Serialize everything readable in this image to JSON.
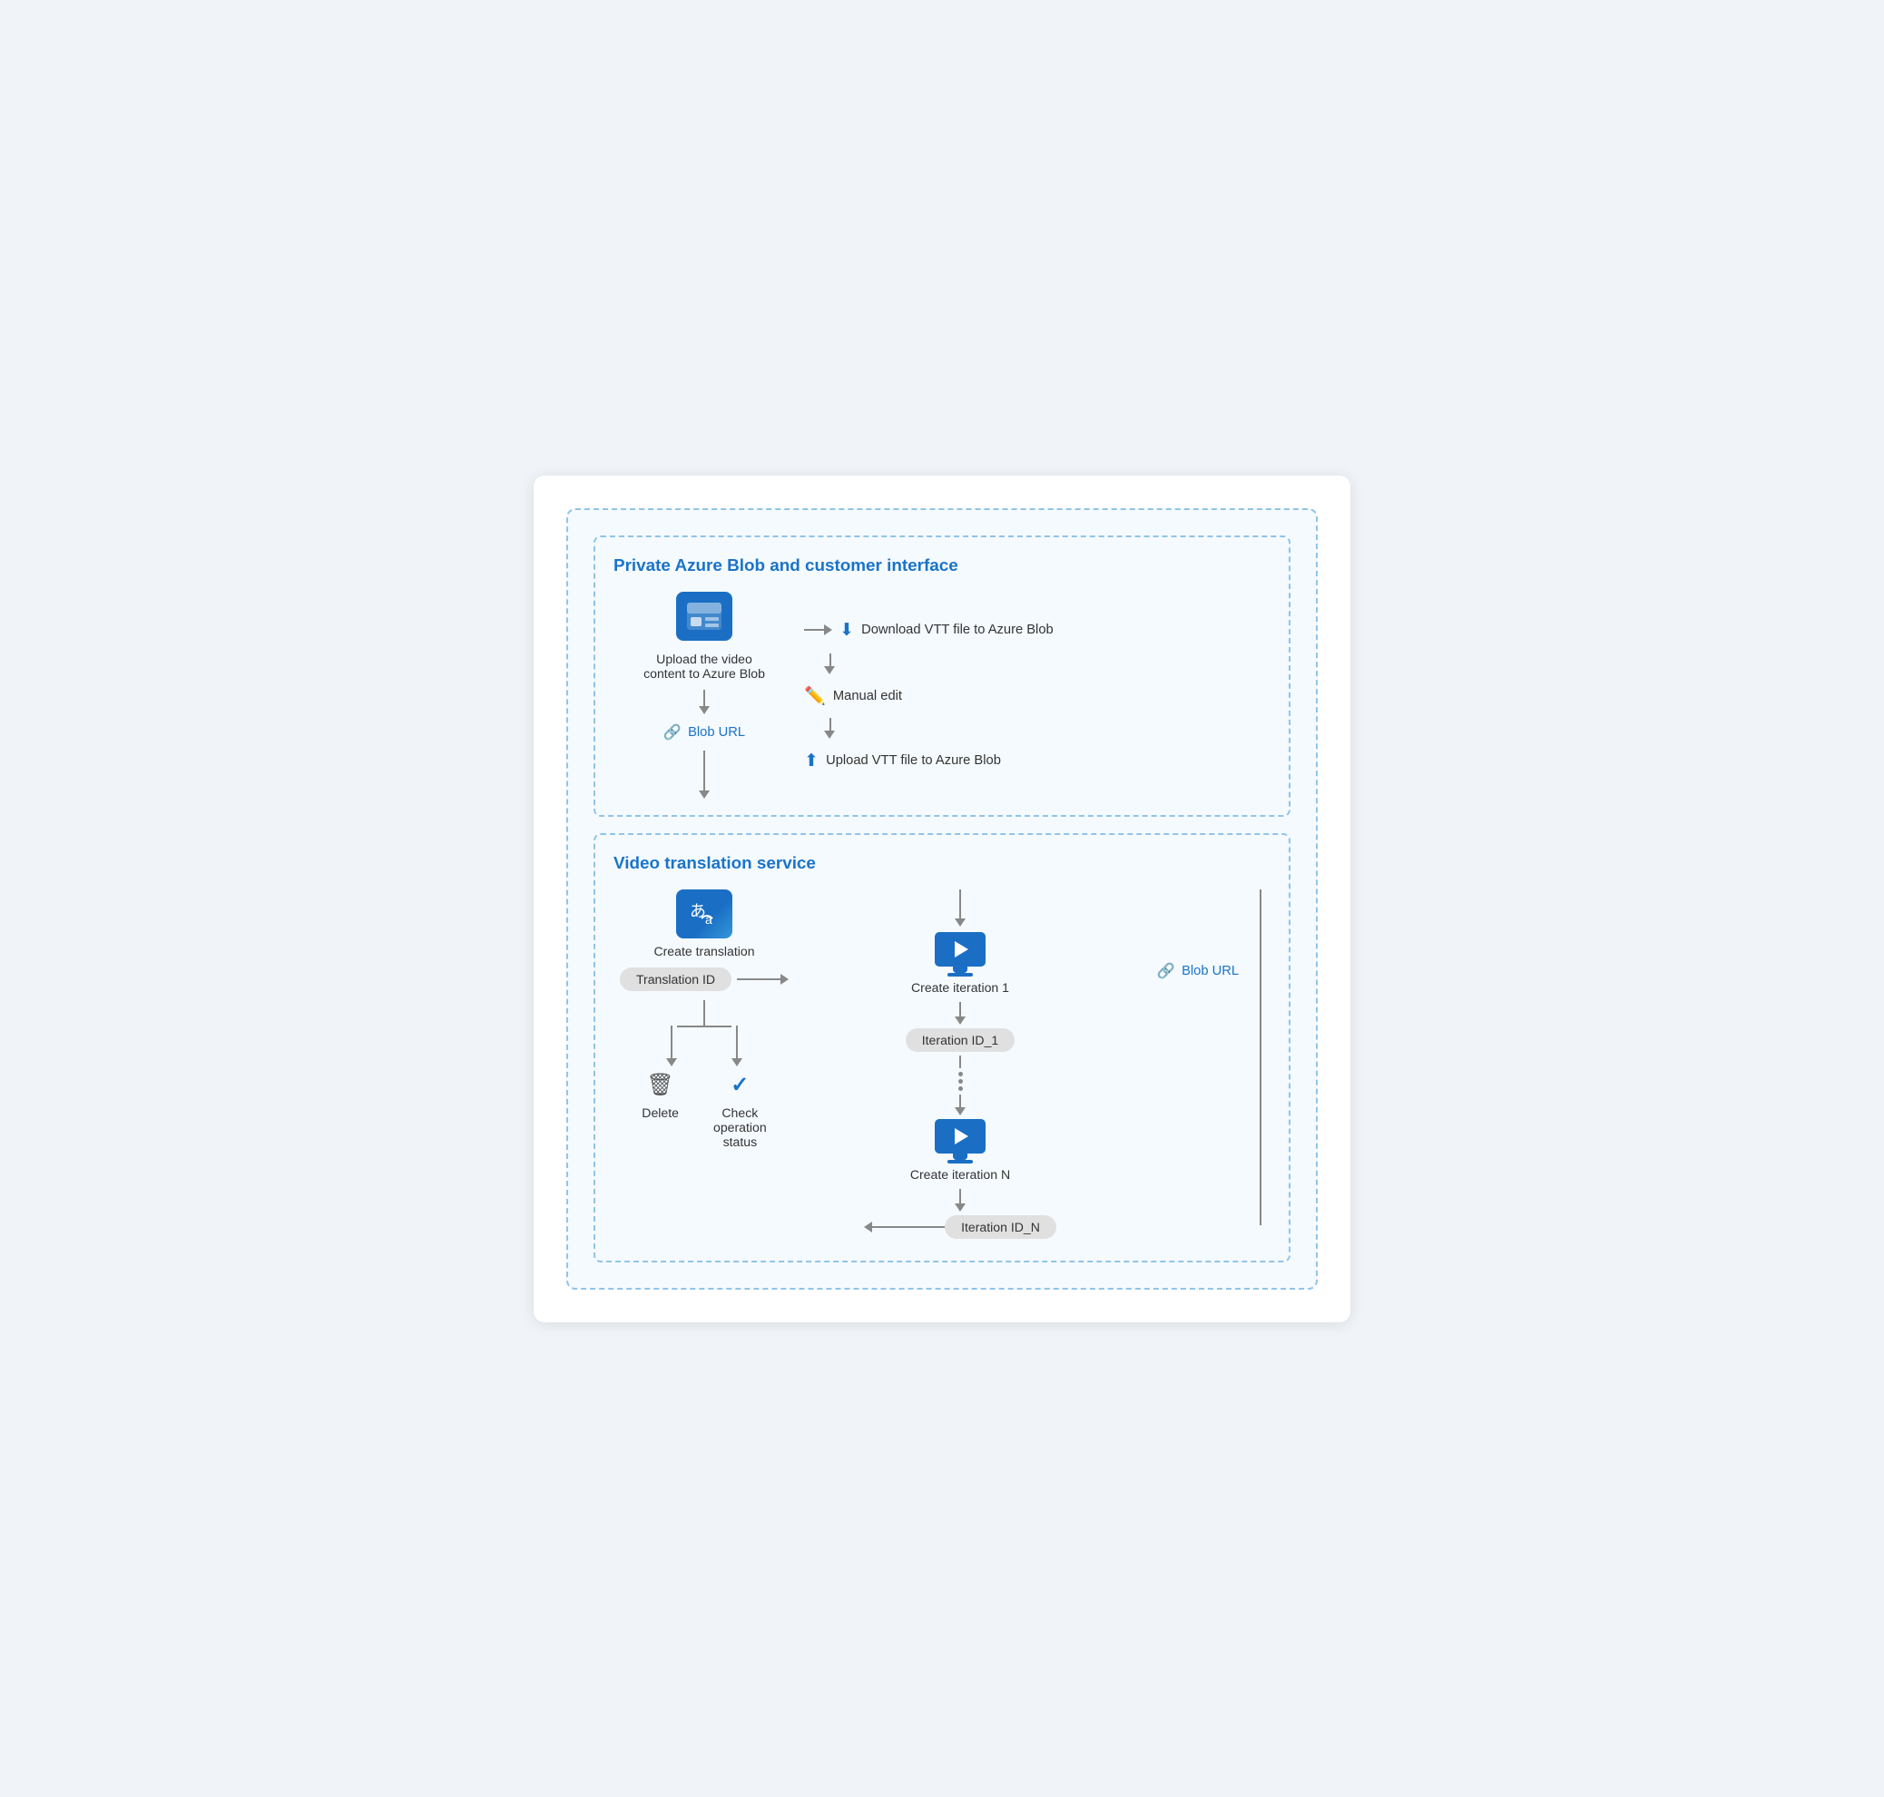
{
  "outer": {
    "top_section": {
      "title": "Private Azure Blob and customer interface",
      "left": {
        "icon_label": "Upload the video\ncontent to Azure Blob",
        "blob_url_label": "Blob URL"
      },
      "right": {
        "step1_label": "Download VTT file to Azure Blob",
        "step2_label": "Manual edit",
        "step3_label": "Upload VTT file to Azure Blob"
      }
    },
    "bottom_section": {
      "title": "Video translation service",
      "left": {
        "icon_label": "Create translation",
        "translation_id_label": "Translation ID",
        "delete_label": "Delete",
        "check_label": "Check\noperation\nstatus"
      },
      "center": {
        "iteration1_label": "Create iteration 1",
        "iteration_id1_label": "Iteration ID_1",
        "dots": "...",
        "iterationN_label": "Create iteration N",
        "iteration_idN_label": "Iteration ID_N"
      },
      "right": {
        "blob_url_label": "Blob URL"
      }
    }
  },
  "icons": {
    "chain": "🔗",
    "translate": "あ→a",
    "monitor_play": "▶",
    "download": "⬇",
    "pencil": "✏",
    "upload": "⬆",
    "trash": "🗑",
    "check": "✓"
  }
}
